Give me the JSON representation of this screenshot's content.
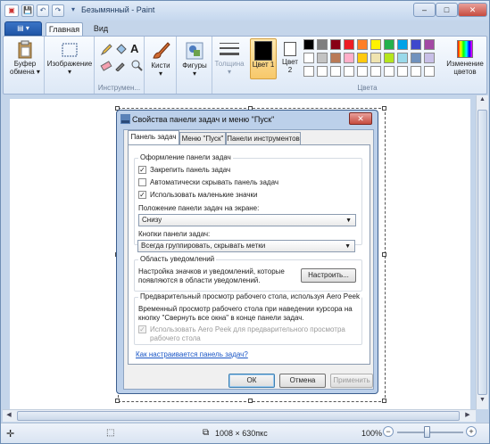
{
  "app": {
    "title": "Безымянный - Paint"
  },
  "window_controls": {
    "minimize": "–",
    "maximize": "□",
    "close": "✕"
  },
  "qat": {
    "save": "💾",
    "undo": "↶",
    "redo": "↷",
    "customize": "▾"
  },
  "ribbon_tabs": {
    "file": "▤ ▾",
    "home": "Главная",
    "view": "Вид"
  },
  "ribbon": {
    "clipboard_label": "Буфер обмена",
    "image_label": "Изображение",
    "tools_label": "Инструмен...",
    "brushes_label": "Кисти",
    "shapes_label": "Фигуры",
    "size_label": "Толщина",
    "color1_label": "Цвет 1",
    "color2_label": "Цвет 2",
    "colors_group_label": "Цвета",
    "edit_colors_label": "Изменение цветов",
    "text_tool": "A",
    "color1_value": "#000000",
    "color2_value": "#ffffff",
    "palette_row1": [
      "#000000",
      "#7f7f7f",
      "#880015",
      "#ed1c24",
      "#ff7f27",
      "#fff200",
      "#22b14c",
      "#00a2e8",
      "#3f48cc",
      "#a349a4"
    ],
    "palette_row2": [
      "#ffffff",
      "#c3c3c3",
      "#b97a57",
      "#ffaec9",
      "#ffc90e",
      "#efe4b0",
      "#b5e61d",
      "#99d9ea",
      "#7092be",
      "#c8bfe7"
    ],
    "palette_row3": [
      "#ffffff",
      "#ffffff",
      "#ffffff",
      "#ffffff",
      "#ffffff",
      "#ffffff",
      "#ffffff",
      "#ffffff",
      "#ffffff",
      "#ffffff"
    ]
  },
  "dialog": {
    "title": "Свойства панели задач и меню \"Пуск\"",
    "close": "✕",
    "tabs": [
      "Панель задач",
      "Меню \"Пуск\"",
      "Панели инструментов"
    ],
    "appearance_legend": "Оформление панели задач",
    "check_lock": "Закрепить панель задач",
    "check_autohide": "Автоматически скрывать панель задач",
    "check_small_icons": "Использовать маленькие значки",
    "position_label": "Положение панели задач на экране:",
    "position_value": "Снизу",
    "buttons_label": "Кнопки панели задач:",
    "buttons_value": "Всегда группировать, скрывать метки",
    "notify_legend": "Область уведомлений",
    "notify_text": "Настройка значков и уведомлений, которые появляются в области уведомлений.",
    "customize_button": "Настроить...",
    "peek_legend": "Предварительный просмотр рабочего стола, используя Aero Peek",
    "peek_text": "Временный просмотр рабочего стола при наведении курсора на кнопку \"Свернуть все окна\" в конце панели задач.",
    "peek_check": "Использовать Aero Peek для предварительного просмотра рабочего стола",
    "help_link": "Как настраивается панель задач?",
    "ok": "ОК",
    "cancel": "Отмена",
    "apply": "Применить",
    "check_mark": "✓"
  },
  "status": {
    "move_icon": "✛",
    "select_icon": "⬚",
    "size_icon": "⧉",
    "dimensions": "1008 × 630пкс",
    "zoom": "100%",
    "zoom_out": "−",
    "zoom_in": "+"
  }
}
